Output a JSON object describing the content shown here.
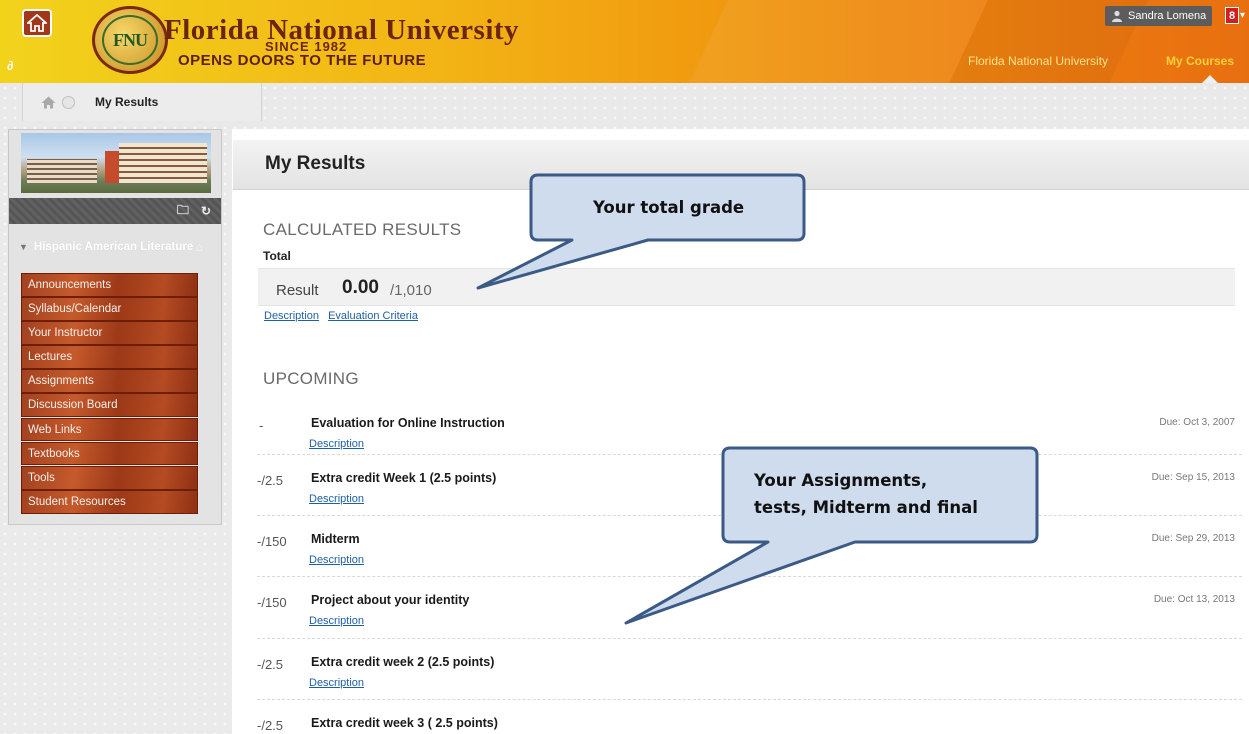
{
  "header": {
    "brand_initials": "FNU",
    "brand_name": "Florida National University",
    "brand_since": "SINCE 1982",
    "brand_tagline": "OPENS DOORS TO THE FUTURE",
    "user_name": "Sandra Lomena",
    "notification_count": "8",
    "nav": [
      "Florida National University",
      "My Courses"
    ]
  },
  "breadcrumb": {
    "current": "My Results"
  },
  "sidebar": {
    "course_title": "Hispanic American Literature",
    "menu": [
      "Announcements",
      "Syllabus/Calendar",
      "Your Instructor",
      "Lectures",
      "Assignments",
      "Discussion Board",
      "Web Links",
      "Textbooks",
      "Tools",
      "Student Resources"
    ]
  },
  "main": {
    "page_title": "My Results",
    "calculated_heading": "CALCULATED RESULTS",
    "total_label": "Total",
    "result_label": "Result",
    "result_value": "0.00",
    "result_max": "/1,010",
    "link_description": "Description",
    "link_criteria": "Evaluation Criteria",
    "upcoming_heading": "UPCOMING",
    "items": [
      {
        "score": "-",
        "name": "Evaluation for Online Instruction",
        "link": "Description",
        "due": "Due: Oct 3, 2007"
      },
      {
        "score": "-/2.5",
        "name": "Extra credit Week 1 (2.5 points)",
        "link": "Description",
        "due": "Due: Sep 15, 2013"
      },
      {
        "score": "-/150",
        "name": "Midterm",
        "link": "Description",
        "due": "Due: Sep 29, 2013"
      },
      {
        "score": "-/150",
        "name": "Project about your identity",
        "link": "Description",
        "due": "Due: Oct 13, 2013"
      },
      {
        "score": "-/2.5",
        "name": "Extra credit week 2 (2.5 points)",
        "link": "Description",
        "due": ""
      },
      {
        "score": "-/2.5",
        "name": "Extra credit week 3 ( 2.5 points)",
        "link": "",
        "due": ""
      }
    ]
  },
  "callouts": {
    "total_grade": "Your total grade",
    "assignments_line1": "Your Assignments,",
    "assignments_line2": "tests, Midterm and final"
  },
  "colors": {
    "header_gold": "#f3b415",
    "header_orange": "#e86f10",
    "menu_brown": "#a3411f",
    "callout_fill": "#cfdcee",
    "callout_border": "#3c5a86",
    "link_blue": "#1f5fa8"
  }
}
